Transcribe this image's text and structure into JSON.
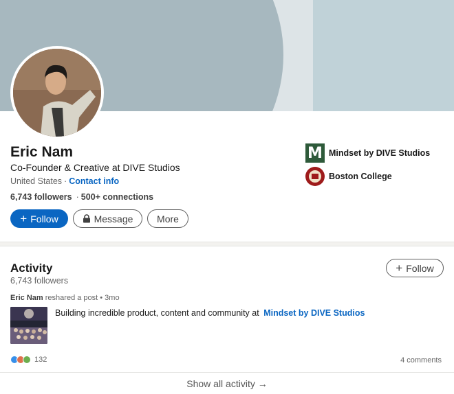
{
  "profile": {
    "name": "Eric Nam",
    "headline": "Co-Founder & Creative at DIVE Studios",
    "location": "United States",
    "separator": "·",
    "contact_info": "Contact info",
    "followers": "6,743 followers",
    "connections_bullet": "·",
    "connections": "500+ connections"
  },
  "actions": {
    "follow": "Follow",
    "message": "Message",
    "more": "More",
    "plus": "+"
  },
  "orgs": [
    {
      "name": "Mindset by DIVE Studios",
      "logo_letter": "M"
    },
    {
      "name": "Boston College"
    }
  ],
  "activity": {
    "title": "Activity",
    "followers": "6,743 followers",
    "follow": "Follow",
    "post": {
      "author": "Eric Nam",
      "action": "reshared a post",
      "time": "• 3mo",
      "text": "Building incredible product, content and community at",
      "link": "Mindset by DIVE Studios",
      "reaction_count": "132",
      "comments": "4 comments"
    },
    "show_all": "Show all activity →"
  },
  "colors": {
    "accent": "#0a66c2",
    "banner": "#a7b8bf"
  }
}
